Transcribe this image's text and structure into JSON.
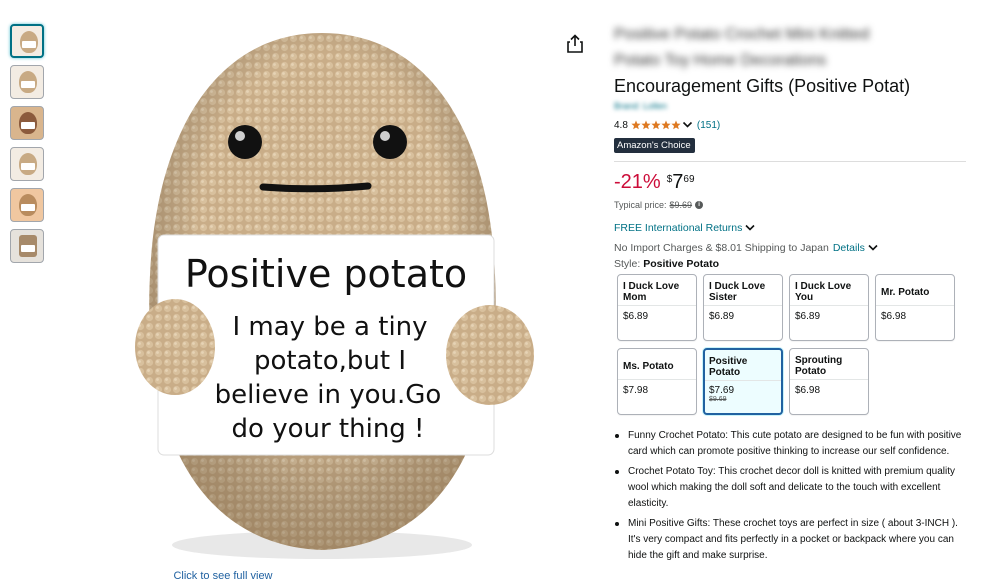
{
  "thumbnails": [
    {
      "name": "thumbnail-1",
      "active": true
    },
    {
      "name": "thumbnail-2",
      "active": false
    },
    {
      "name": "thumbnail-3",
      "active": false
    },
    {
      "name": "thumbnail-4",
      "active": false
    },
    {
      "name": "thumbnail-5",
      "active": false
    },
    {
      "name": "thumbnail-6",
      "active": false
    }
  ],
  "main_image": {
    "card_title": "Positive potato",
    "card_lines": [
      "I may be a tiny",
      "potato,but I",
      "believe in you.Go",
      "do your thing !"
    ],
    "click_full_view": "Click to see full view"
  },
  "share_icon": "share-icon",
  "product": {
    "blurred_title_line1": "Positive Potato Crochet Mini Knitted",
    "blurred_title_line2": "Potato Toy Home Decorations",
    "title": "Encouragement Gifts (Positive Potat)",
    "brand": "Brand: Lollen",
    "rating": "4.8",
    "stars": 4.8,
    "rating_count": "(151)",
    "badge": "Amazon's Choice"
  },
  "price": {
    "discount": "-21%",
    "symbol": "$",
    "whole": "7",
    "fraction": "69",
    "typical_label": "Typical price:",
    "typical_value": "$9.69"
  },
  "shipping": {
    "returns": "FREE International Returns",
    "import_text": "No Import Charges & $8.01 Shipping to Japan",
    "details": "Details"
  },
  "style": {
    "label": "Style:",
    "selected": "Positive Potato",
    "options": [
      {
        "name": "I Duck Love Mom",
        "price": "$6.89",
        "strike": ""
      },
      {
        "name": "I Duck Love Sister",
        "price": "$6.89",
        "strike": ""
      },
      {
        "name": "I Duck Love You",
        "price": "$6.89",
        "strike": ""
      },
      {
        "name": "Mr. Potato",
        "price": "$6.98",
        "strike": ""
      },
      {
        "name": "Ms. Potato",
        "price": "$7.98",
        "strike": ""
      },
      {
        "name": "Positive Potato",
        "price": "$7.69",
        "strike": "$9.69"
      },
      {
        "name": "Sprouting Potato",
        "price": "$6.98",
        "strike": ""
      }
    ]
  },
  "bullets": [
    "Funny Crochet Potato: This cute potato are designed to be fun with positive card which can promote positive thinking to increase our self confidence.",
    "Crochet Potato Toy: This crochet decor doll is knitted with premium quality wool which making the doll soft and delicate to the touch with excellent elasticity.",
    "Mini Positive Gifts: These crochet toys are perfect in size ( about 3-INCH ). It's very compact and fits perfectly in a pocket or backpack where you can hide the gift and make surprise."
  ],
  "colors": {
    "link": "#007185",
    "discount": "#cc0c39",
    "star": "#de7921",
    "badge_bg": "#232f3e",
    "selected_border": "#2162a1"
  }
}
